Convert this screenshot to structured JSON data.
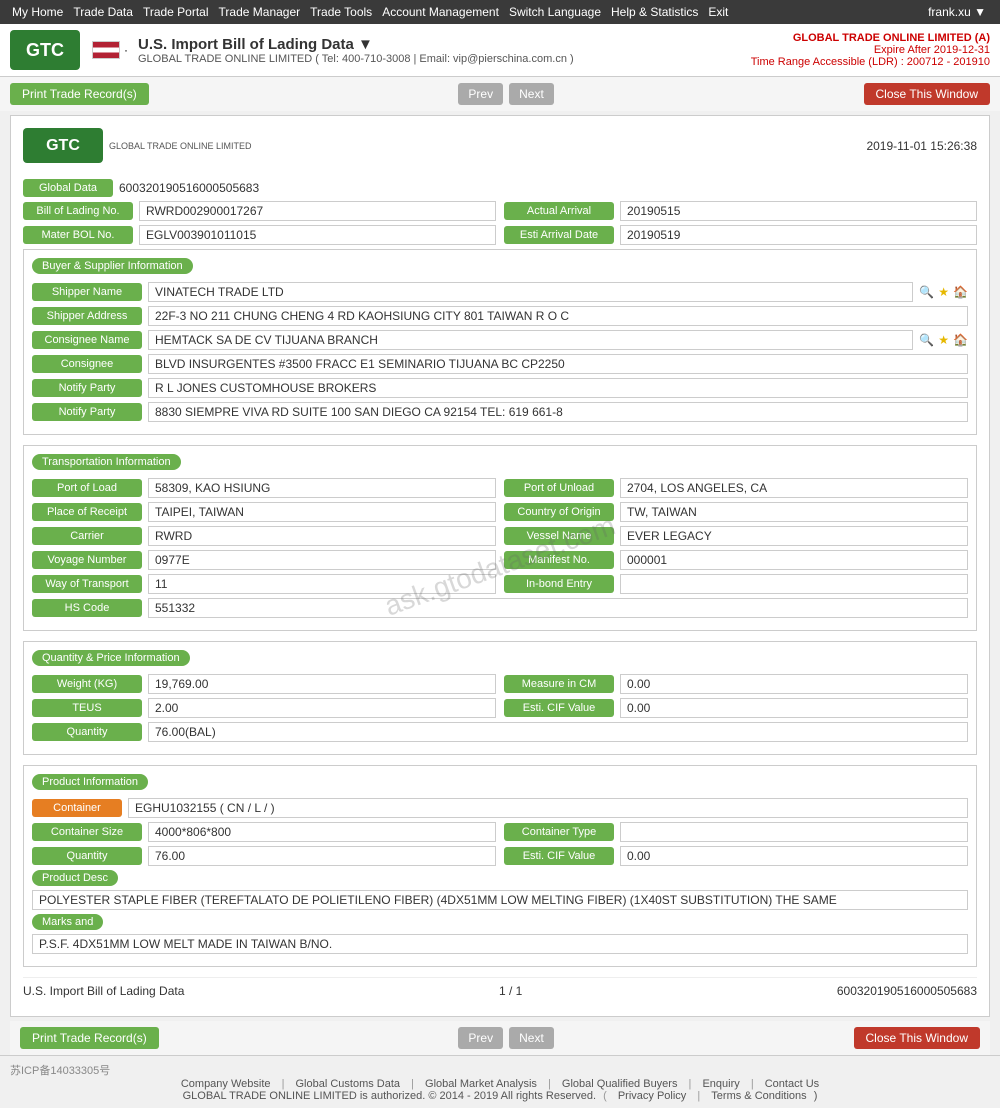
{
  "nav": {
    "items": [
      {
        "label": "My Home",
        "arrow": "▼"
      },
      {
        "label": "Trade Data",
        "arrow": "▼"
      },
      {
        "label": "Trade Portal",
        "arrow": "▼"
      },
      {
        "label": "Trade Manager",
        "arrow": "▼"
      },
      {
        "label": "Trade Tools",
        "arrow": "▼"
      },
      {
        "label": "Account Management",
        "arrow": "▼"
      },
      {
        "label": "Switch Language",
        "arrow": "▼"
      },
      {
        "label": "Help & Statistics",
        "arrow": "▼"
      },
      {
        "label": "Exit"
      }
    ],
    "user": "frank.xu ▼"
  },
  "header": {
    "logo_text": "GTC",
    "logo_sub": "GLOBAL TRADE ONLINE LIMITED",
    "flag_alt": "US Flag",
    "separator": "·",
    "title": "U.S. Import Bill of Lading Data ▼",
    "subtitle": "GLOBAL TRADE ONLINE LIMITED ( Tel: 400-710-3008 | Email: vip@pierschina.com.cn )",
    "company": "GLOBAL TRADE ONLINE LIMITED (A)",
    "expire": "Expire After 2019-12-31",
    "time_range": "Time Range Accessible (LDR) : 200712 - 201910"
  },
  "toolbar": {
    "print_label": "Print Trade Record(s)",
    "prev_label": "Prev",
    "next_label": "Next",
    "close_label": "Close This Window"
  },
  "record": {
    "logo_text": "GTC",
    "logo_sub": "GLOBAL TRADE ONLINE LIMITED",
    "timestamp": "2019-11-01 15:26:38",
    "global_data_label": "Global Data",
    "global_data_value": "600320190516000505683",
    "bol_label": "Bill of Lading No.",
    "bol_value": "RWRD002900017267",
    "actual_arrival_label": "Actual Arrival",
    "actual_arrival_value": "20190515",
    "mater_bol_label": "Mater BOL No.",
    "mater_bol_value": "EGLV003901011015",
    "esti_arrival_label": "Esti Arrival Date",
    "esti_arrival_value": "20190519"
  },
  "buyer_supplier": {
    "section_title": "Buyer & Supplier Information",
    "shipper_name_label": "Shipper Name",
    "shipper_name_value": "VINATECH TRADE LTD",
    "shipper_address_label": "Shipper Address",
    "shipper_address_value": "22F-3 NO 211 CHUNG CHENG 4 RD KAOHSIUNG CITY 801 TAIWAN R O C",
    "consignee_name_label": "Consignee Name",
    "consignee_name_value": "HEMTACK SA DE CV TIJUANA BRANCH",
    "consignee_label": "Consignee",
    "consignee_value": "BLVD INSURGENTES #3500 FRACC E1 SEMINARIO TIJUANA BC CP2250",
    "notify_party_label": "Notify Party",
    "notify_party_value1": "R L JONES CUSTOMHOUSE BROKERS",
    "notify_party_value2": "8830 SIEMPRE VIVA RD SUITE 100 SAN DIEGO CA 92154 TEL: 619 661-8"
  },
  "transport": {
    "section_title": "Transportation Information",
    "port_of_load_label": "Port of Load",
    "port_of_load_value": "58309, KAO HSIUNG",
    "port_of_unload_label": "Port of Unload",
    "port_of_unload_value": "2704, LOS ANGELES, CA",
    "place_of_receipt_label": "Place of Receipt",
    "place_of_receipt_value": "TAIPEI, TAIWAN",
    "country_of_origin_label": "Country of Origin",
    "country_of_origin_value": "TW, TAIWAN",
    "carrier_label": "Carrier",
    "carrier_value": "RWRD",
    "vessel_name_label": "Vessel Name",
    "vessel_name_value": "EVER LEGACY",
    "voyage_number_label": "Voyage Number",
    "voyage_number_value": "0977E",
    "manifest_no_label": "Manifest No.",
    "manifest_no_value": "000001",
    "way_of_transport_label": "Way of Transport",
    "way_of_transport_value": "11",
    "in_bond_entry_label": "In-bond Entry",
    "in_bond_entry_value": "",
    "hs_code_label": "HS Code",
    "hs_code_value": "551332"
  },
  "quantity_price": {
    "section_title": "Quantity & Price Information",
    "weight_kg_label": "Weight (KG)",
    "weight_kg_value": "19,769.00",
    "measure_in_cm_label": "Measure in CM",
    "measure_in_cm_value": "0.00",
    "teus_label": "TEUS",
    "teus_value": "2.00",
    "esti_cif_label": "Esti. CIF Value",
    "esti_cif_value": "0.00",
    "quantity_label": "Quantity",
    "quantity_value": "76.00(BAL)"
  },
  "product": {
    "section_title": "Product Information",
    "container_label": "Container",
    "container_value": "EGHU1032155 ( CN / L / )",
    "container_size_label": "Container Size",
    "container_size_value": "4000*806*800",
    "container_type_label": "Container Type",
    "container_type_value": "",
    "quantity_label": "Quantity",
    "quantity_value": "76.00",
    "esti_cif_label": "Esti. CIF Value",
    "esti_cif_value": "0.00",
    "product_desc_label": "Product Desc",
    "product_desc_value": "POLYESTER STAPLE FIBER (TEREFTALATO DE POLIETILENO FIBER) (4DX51MM LOW MELTING FIBER) (1X40ST SUBSTITUTION) THE SAME",
    "marks_and_label": "Marks and",
    "marks_and_value": "P.S.F. 4DX51MM LOW MELT MADE IN TAIWAN B/NO."
  },
  "record_footer": {
    "left": "U.S. Import Bill of Lading Data",
    "page": "1 / 1",
    "right": "600320190516000505683"
  },
  "site_footer": {
    "icp": "苏ICP备14033305号",
    "links": [
      "Company Website",
      "Global Customs Data",
      "Global Market Analysis",
      "Global Qualified Buyers",
      "Enquiry",
      "Contact Us"
    ],
    "copyright": "GLOBAL TRADE ONLINE LIMITED is authorized. © 2014 - 2019 All rights Reserved.",
    "policy_links": [
      "Privacy Policy",
      "Terms & Conditions"
    ]
  }
}
